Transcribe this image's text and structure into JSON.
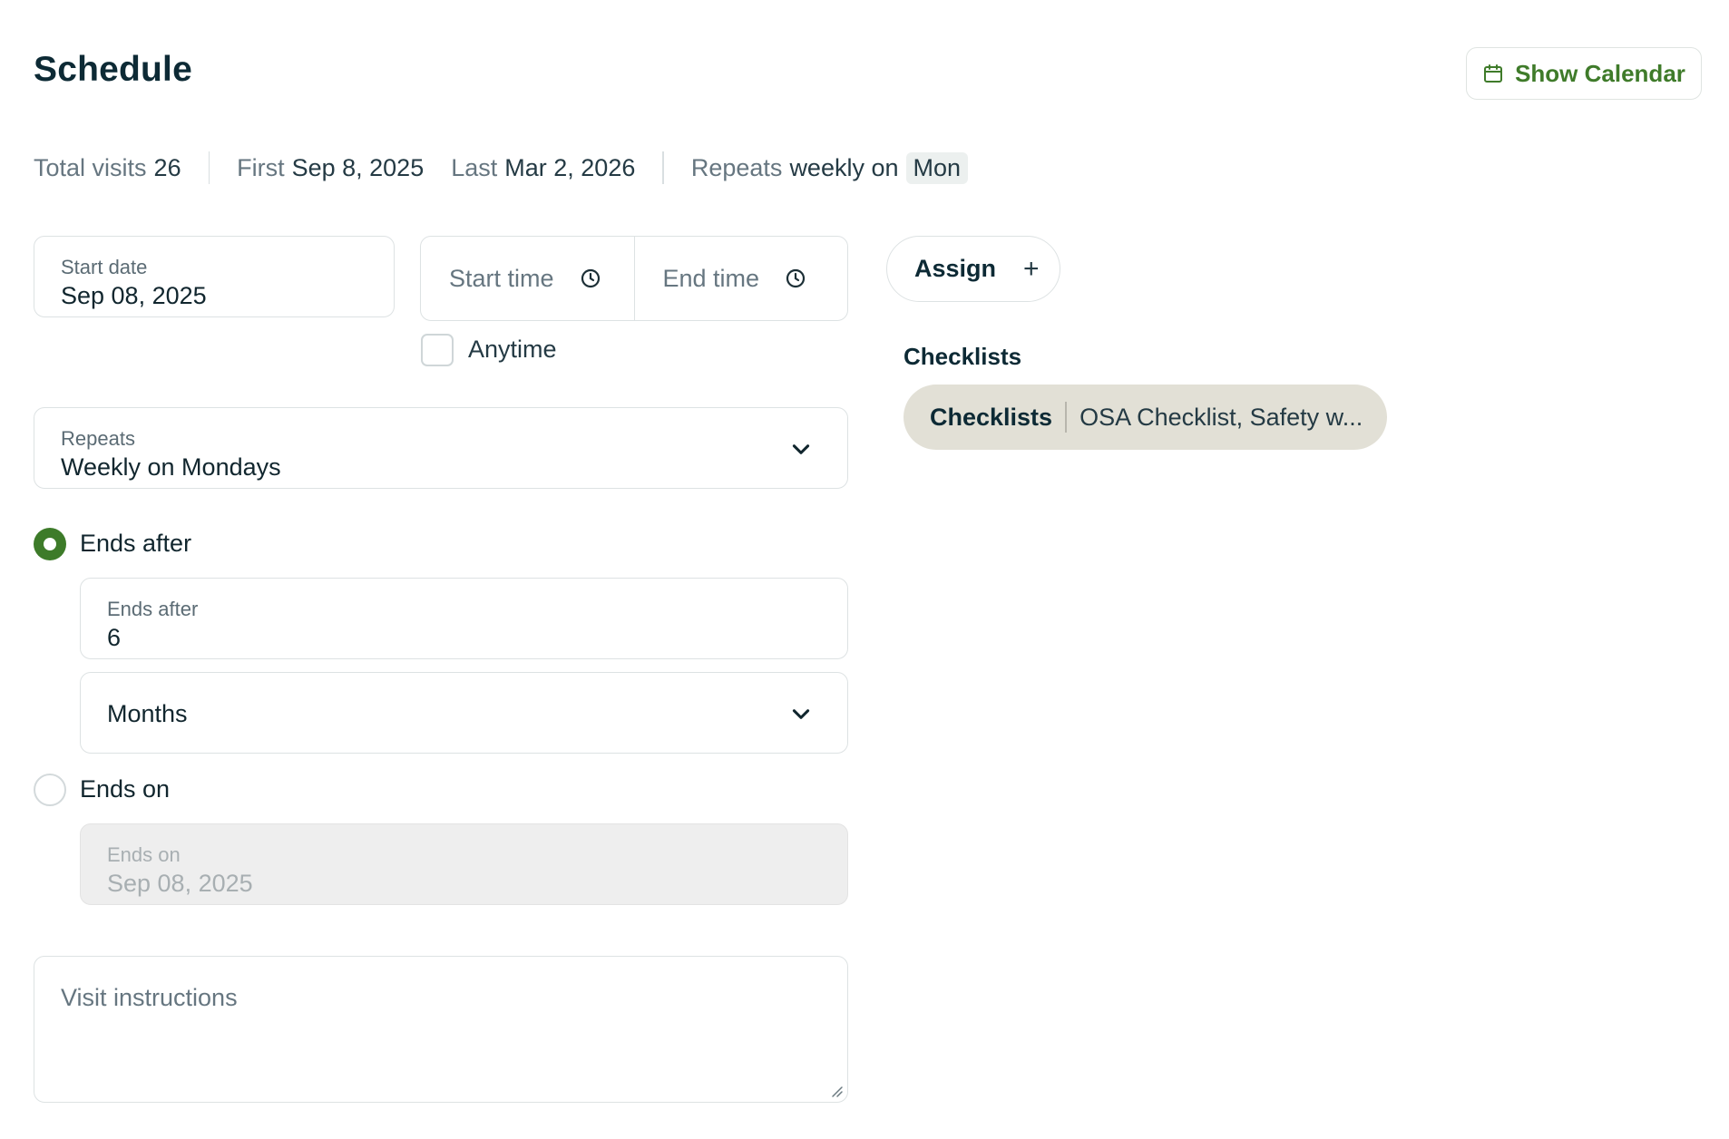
{
  "header": {
    "title": "Schedule",
    "calendar_button": "Show Calendar"
  },
  "summary": {
    "total_label": "Total visits",
    "total_value": "26",
    "first_label": "First",
    "first_value": "Sep 8, 2025",
    "last_label": "Last",
    "last_value": "Mar 2, 2026",
    "repeats_label": "Repeats",
    "repeats_value": "weekly on",
    "repeats_day": "Mon"
  },
  "start_date": {
    "label": "Start date",
    "value": "Sep 08, 2025"
  },
  "start_time": {
    "placeholder": "Start time"
  },
  "end_time": {
    "placeholder": "End time"
  },
  "anytime": {
    "label": "Anytime",
    "checked": false
  },
  "repeats": {
    "label": "Repeats",
    "value": "Weekly on Mondays"
  },
  "ends_after": {
    "radio_label": "Ends after",
    "selected": true,
    "count_label": "Ends after",
    "count_value": "6",
    "unit_value": "Months"
  },
  "ends_on": {
    "radio_label": "Ends on",
    "selected": false,
    "date_label": "Ends on",
    "date_value": "Sep 08, 2025"
  },
  "instructions": {
    "placeholder": "Visit instructions"
  },
  "assign": {
    "label": "Assign"
  },
  "checklists": {
    "heading": "Checklists",
    "pill_key": "Checklists",
    "pill_value": "OSA Checklist, Safety w..."
  },
  "colors": {
    "accent": "#3d7b29",
    "chip_bg": "#e2e0d6",
    "border": "#dde2e3"
  }
}
